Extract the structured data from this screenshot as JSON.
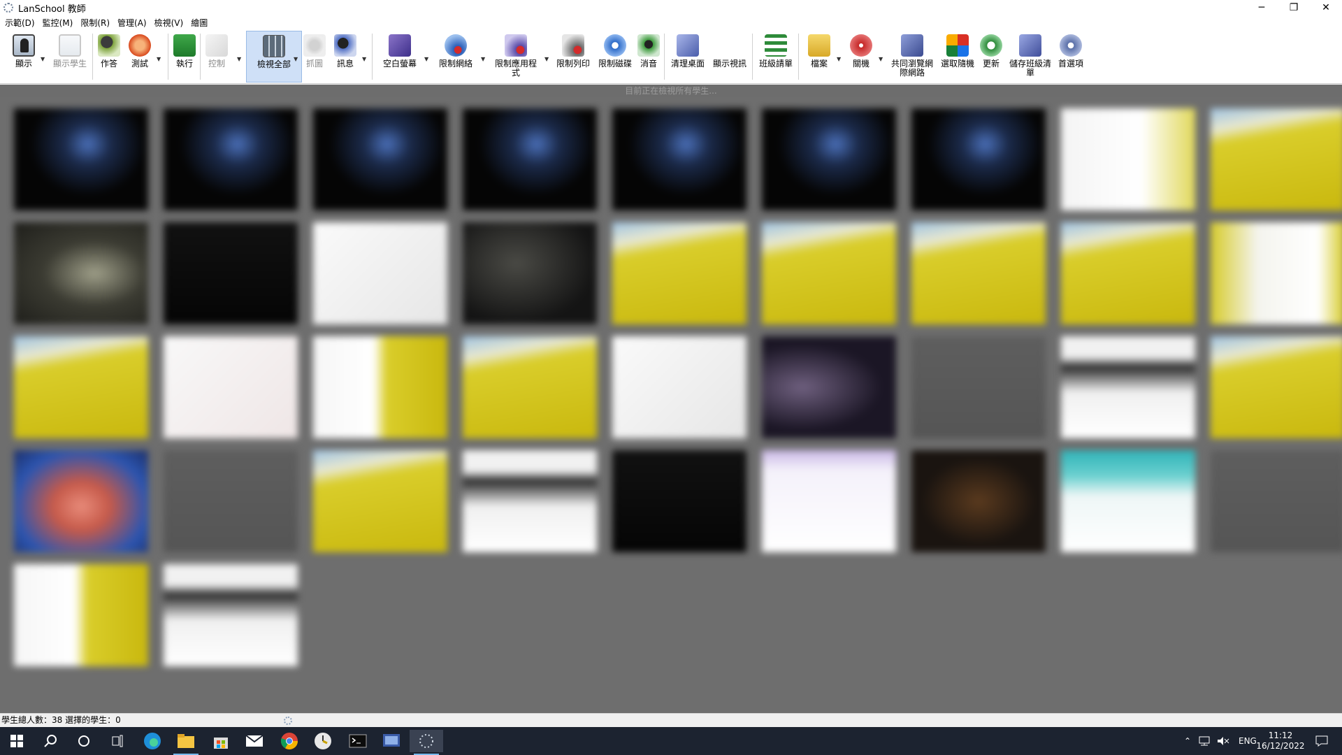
{
  "window": {
    "title": "LanSchool 教師",
    "minimize_glyph": "─",
    "restore_glyph": "❐",
    "close_glyph": "✕"
  },
  "menu": [
    "示範(D)",
    "監控(M)",
    "限制(R)",
    "管理(A)",
    "檢視(V)",
    "繪圖"
  ],
  "toolbar": {
    "show": "顯示",
    "show_student": "顯示學生",
    "assignment": "作答",
    "test": "測試",
    "run": "執行",
    "control": "控制",
    "view_all": "檢視全部",
    "capture": "抓圖",
    "message": "訊息",
    "blank_screen": "空白螢幕",
    "limit_web": "限制網絡",
    "limit_apps_line1": "限制應用程",
    "limit_apps_line2": "式",
    "limit_print": "限制列印",
    "limit_audio": "限制磁碟",
    "mute": "消音",
    "clear_desktop": "清理桌面",
    "show_video": "顯示視訊",
    "class_list": "班級請單",
    "files": "檔案",
    "power": "關機",
    "shared_browse_line1": "共同瀏覽網",
    "shared_browse_line2": "際網路",
    "random_pick": "選取隨機",
    "refresh": "更新",
    "save_class_line1": "儲存班級清",
    "save_class_line2": "單",
    "preferences": "首選項"
  },
  "viewing_status": "目前正在檢視所有學生...",
  "status_bar": {
    "text": "學生總人數：38 選擇的學生：0"
  },
  "thumbnails": {
    "count": 38,
    "themes": [
      "dark-blue",
      "dark-blue",
      "dark-blue",
      "dark-blue",
      "dark-blue",
      "dark-blue",
      "dark-blue",
      "white-purple",
      "yellow",
      "dark-gray",
      "black",
      "white",
      "dark",
      "yellow",
      "yellow",
      "yellow",
      "yellow",
      "yellow-white",
      "yellow",
      "white-red",
      "white-yellow",
      "yellow",
      "white",
      "dark-purple",
      "gray",
      "white-dark",
      "yellow",
      "blue-red",
      "gray",
      "yellow",
      "white-dark",
      "black",
      "white-lilac",
      "dark-brown",
      "teal-white",
      "gray",
      "white-yellow",
      "white-dark"
    ]
  },
  "taskbar": {
    "language": "ENG",
    "time": "11:12",
    "date": "16/12/2022"
  },
  "colors": {
    "thumb_bg": "#6e6e6e",
    "taskbar": "#1c2330",
    "active_tool": "#cfe0f7"
  }
}
